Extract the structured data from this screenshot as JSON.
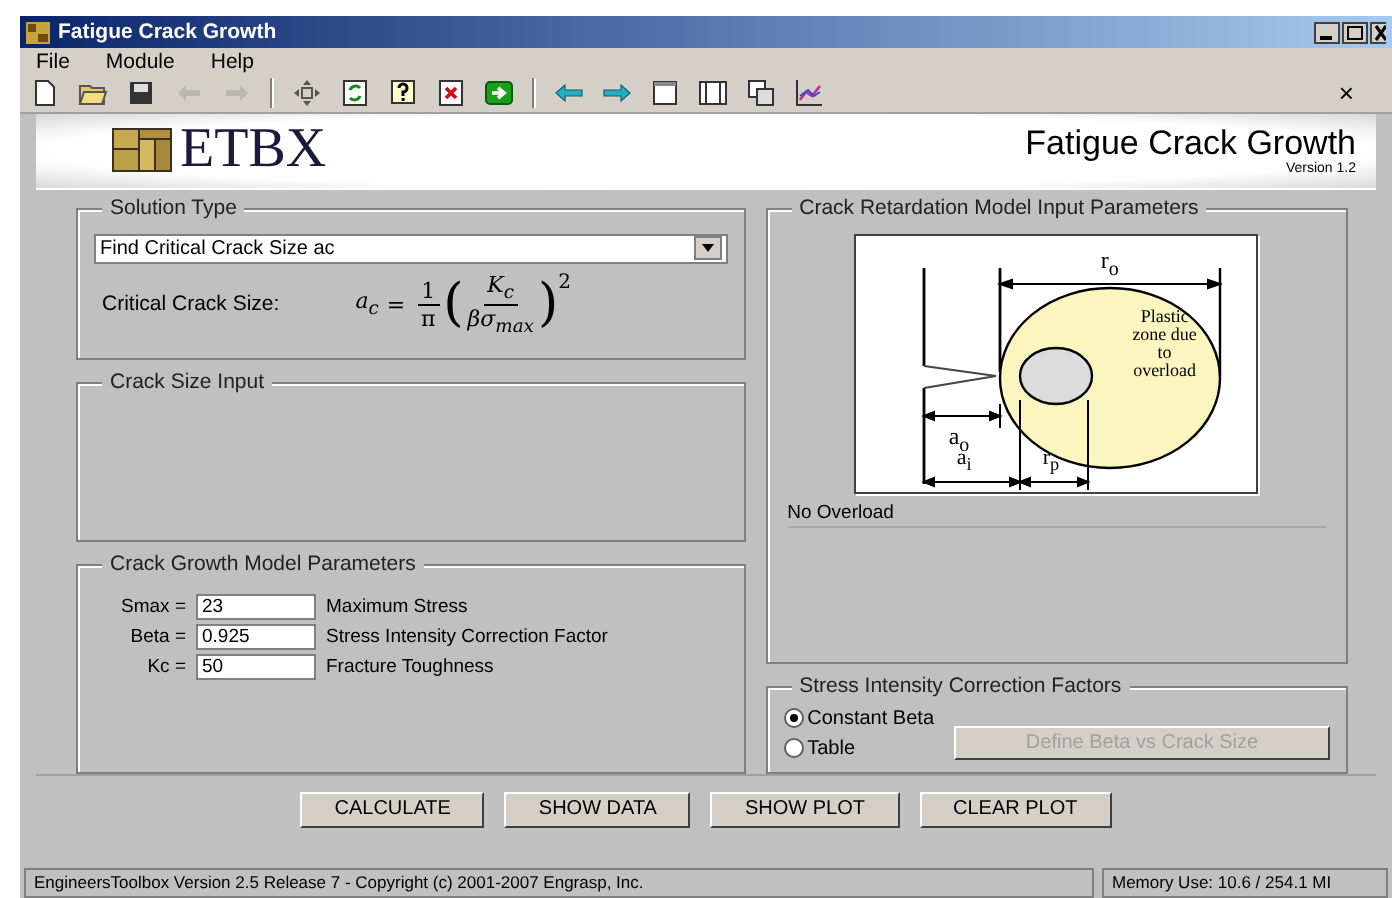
{
  "window": {
    "title": "Fatigue Crack Growth"
  },
  "menu": [
    "File",
    "Module",
    "Help"
  ],
  "toolbar": [
    {
      "kind": "new",
      "disabled": false
    },
    {
      "kind": "open",
      "disabled": false
    },
    {
      "kind": "save",
      "disabled": false
    },
    {
      "kind": "back",
      "disabled": true
    },
    {
      "kind": "forward",
      "disabled": true
    },
    {
      "kind": "sep"
    },
    {
      "kind": "move",
      "disabled": false
    },
    {
      "kind": "refresh",
      "disabled": false
    },
    {
      "kind": "help",
      "disabled": false
    },
    {
      "kind": "delete",
      "disabled": false
    },
    {
      "kind": "go",
      "disabled": false
    },
    {
      "kind": "sep"
    },
    {
      "kind": "left",
      "disabled": false
    },
    {
      "kind": "right",
      "disabled": false
    },
    {
      "kind": "page",
      "disabled": false
    },
    {
      "kind": "grid",
      "disabled": false
    },
    {
      "kind": "copy",
      "disabled": false
    },
    {
      "kind": "chart",
      "disabled": false
    }
  ],
  "toolbar_close": "×",
  "banner": {
    "logo": "ETBX",
    "title": "Fatigue Crack Growth",
    "version": "Version 1.2"
  },
  "solution_type": {
    "title": "Solution Type",
    "value": "Find Critical Crack Size ac",
    "label": "Critical Crack Size:",
    "formula": {
      "lhs": "a$_{c}$",
      "eq": "=",
      "num": "1",
      "den": "π",
      "open": "(",
      "inner_num": "K$_{c}$",
      "inner_den": "βσ$_{max}$",
      "close": ")",
      "power": "2"
    }
  },
  "crack_size_input": {
    "title": "Crack Size Input"
  },
  "growth_params": {
    "title": "Crack Growth Model Parameters",
    "rows": [
      {
        "label": "Smax =",
        "value": "23",
        "desc": "Maximum Stress"
      },
      {
        "label": "Beta =",
        "value": "0.925",
        "desc": "Stress Intensity Correction Factor"
      },
      {
        "label": "Kc =",
        "value": "50",
        "desc": "Fracture Toughness"
      }
    ]
  },
  "retardation": {
    "title": "Crack Retardation Model Input Parameters",
    "diagram": {
      "r_o": "r$_{o}$",
      "zone": "Plastic zone due to overload",
      "a_o": "a$_{o}$",
      "a_i": "a$_{i}$",
      "r_p": "r$_{p}$"
    },
    "model": "No Overload"
  },
  "correction": {
    "title": "Stress Intensity Correction Factors",
    "options": [
      {
        "label": "Constant Beta",
        "selected": true
      },
      {
        "label": "Table",
        "selected": false
      }
    ],
    "define_button": {
      "label": "Define Beta vs Crack Size",
      "disabled": true
    }
  },
  "buttons": [
    "CALCULATE",
    "SHOW DATA",
    "SHOW PLOT",
    "CLEAR PLOT"
  ],
  "status_bar": {
    "text": "EngineersToolbox Version 2.5 Release 7 - Copyright (c) 2001-2007 Engrasp, Inc.",
    "memory": "Memory Use: 10.6 / 254.1 MI"
  }
}
